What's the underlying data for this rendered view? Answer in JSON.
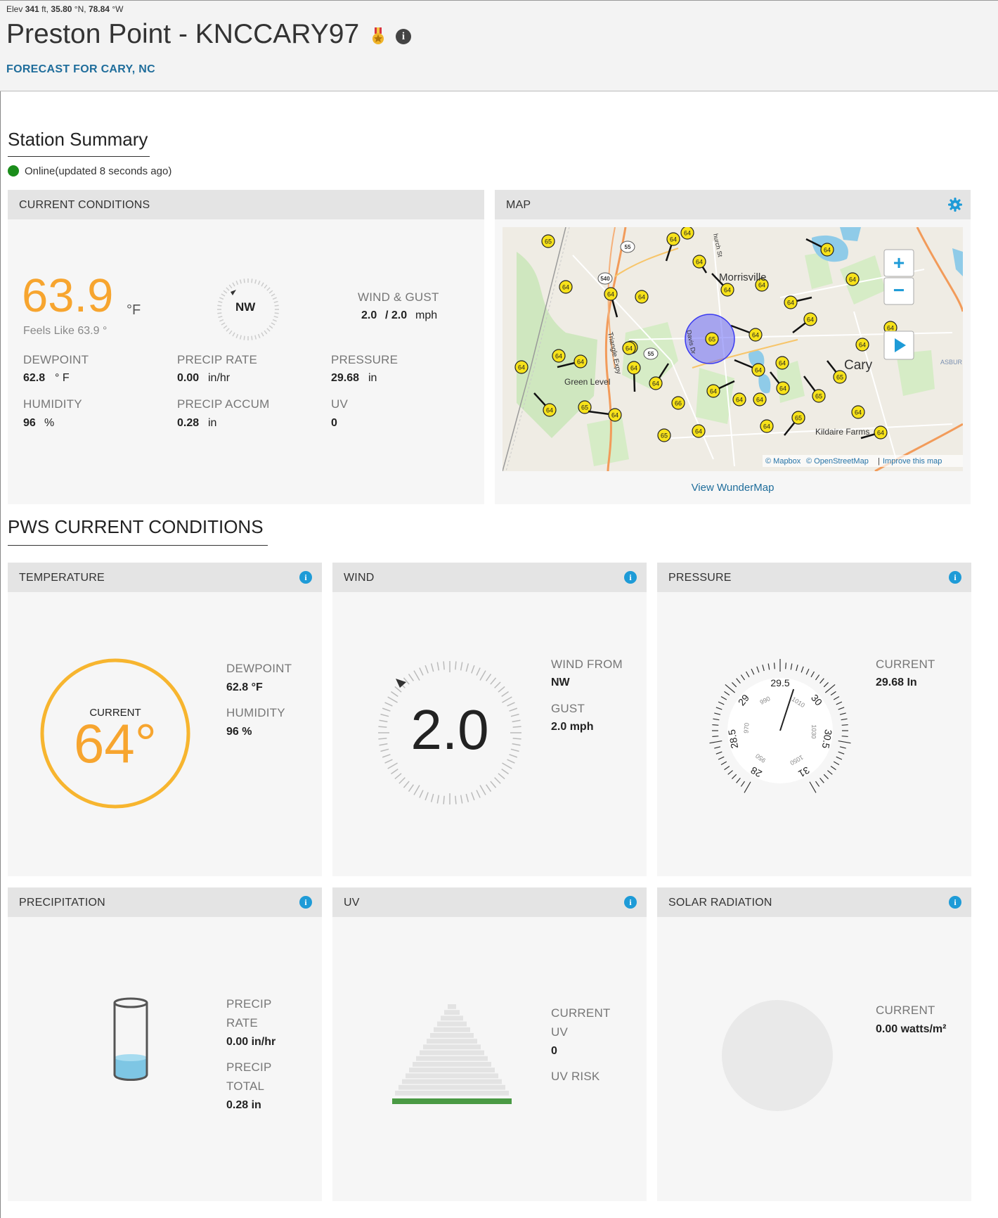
{
  "header": {
    "elev_prefix": "Elev",
    "elev_value": "341",
    "elev_unit": "ft,",
    "lat_value": "35.80",
    "lat_unit": "°N,",
    "lon_value": "78.84",
    "lon_unit": "°W",
    "title": "Preston Point - KNCCARY97",
    "forecast_link": "FORECAST FOR CARY, NC"
  },
  "summary": {
    "heading": "Station Summary",
    "status": "Online(updated 8 seconds ago)"
  },
  "current": {
    "panel_title": "CURRENT CONDITIONS",
    "temp": "63.9",
    "temp_unit": "°F",
    "feels_like": "Feels Like 63.9 °",
    "wind_dir": "NW",
    "wind_gust_label": "WIND & GUST",
    "wind_value": "2.0",
    "gust_value": "/ 2.0",
    "wind_unit": "mph",
    "dewpoint_label": "DEWPOINT",
    "dewpoint_value": "62.8",
    "dewpoint_unit": "° F",
    "precip_rate_label": "PRECIP RATE",
    "precip_rate_value": "0.00",
    "precip_rate_unit": "in/hr",
    "pressure_label": "PRESSURE",
    "pressure_value": "29.68",
    "pressure_unit": "in",
    "humidity_label": "HUMIDITY",
    "humidity_value": "96",
    "humidity_unit": "%",
    "precip_accum_label": "PRECIP ACCUM",
    "precip_accum_value": "0.28",
    "precip_accum_unit": "in",
    "uv_label": "UV",
    "uv_value": "0"
  },
  "map": {
    "panel_title": "MAP",
    "view_link": "View WunderMap",
    "attribution_mapbox": "© Mapbox",
    "attribution_osm": "© OpenStreetMap",
    "attribution_sep": "|",
    "attribution_improve": "Improve this map",
    "zoom_in": "+",
    "zoom_out": "−",
    "places": [
      "Morrisville",
      "Cary",
      "Green Level",
      "Kildaire Farms",
      "Triangle Expy",
      "Davis Dr",
      "hurch St",
      "ASBUR"
    ],
    "road_badges": [
      "55",
      "540",
      "55"
    ],
    "markers": [
      "65",
      "64",
      "64",
      "64",
      "64",
      "64",
      "64",
      "64",
      "64",
      "64",
      "64",
      "64",
      "64",
      "64",
      "64",
      "64",
      "64",
      "64",
      "64",
      "65",
      "64",
      "64",
      "64",
      "65",
      "64",
      "64",
      "66",
      "64",
      "64",
      "64",
      "64",
      "64",
      "65",
      "64",
      "64",
      "64",
      "65",
      "64",
      "64",
      "65",
      "64",
      "64",
      "65"
    ],
    "colors": {
      "marker": "#f7e21a",
      "highlight": "#4b4bf5"
    }
  },
  "pws": {
    "heading": "PWS CURRENT CONDITIONS",
    "temperature": {
      "title": "TEMPERATURE",
      "current_label": "CURRENT",
      "current_value": "64°",
      "dewpoint_label": "DEWPOINT",
      "dewpoint_value": "62.8 °F",
      "humidity_label": "HUMIDITY",
      "humidity_value": "96 %"
    },
    "wind": {
      "title": "WIND",
      "speed": "2.0",
      "from_label": "WIND FROM",
      "from_value": "NW",
      "gust_label": "GUST",
      "gust_value": "2.0 mph"
    },
    "pressure": {
      "title": "PRESSURE",
      "current_label": "CURRENT",
      "current_value": "29.68 In",
      "gauge_labels_in": [
        "28",
        "28.5",
        "29",
        "29.5",
        "30",
        "30.5",
        "31"
      ],
      "gauge_labels_mb": [
        "950",
        "970",
        "990",
        "1010",
        "1030",
        "1050"
      ],
      "needle_value_in": 29.68
    },
    "precipitation": {
      "title": "PRECIPITATION",
      "rate_label_1": "PRECIP",
      "rate_label_2": "RATE",
      "rate_value": "0.00 in/hr",
      "total_label_1": "PRECIP",
      "total_label_2": "TOTAL",
      "total_value": "0.28 in"
    },
    "uv": {
      "title": "UV",
      "current_label_1": "CURRENT",
      "current_label_2": "UV",
      "current_value": "0",
      "risk_label": "UV RISK"
    },
    "solar": {
      "title": "SOLAR RADIATION",
      "current_label": "CURRENT",
      "current_value": "0.00 watts/m²"
    }
  },
  "colors": {
    "temp_orange": "#f7a52f",
    "online_green": "#1b8d1b",
    "info_blue": "#1e9bd7",
    "link_blue": "#1f6d9b",
    "uv_green": "#4a9a44"
  }
}
